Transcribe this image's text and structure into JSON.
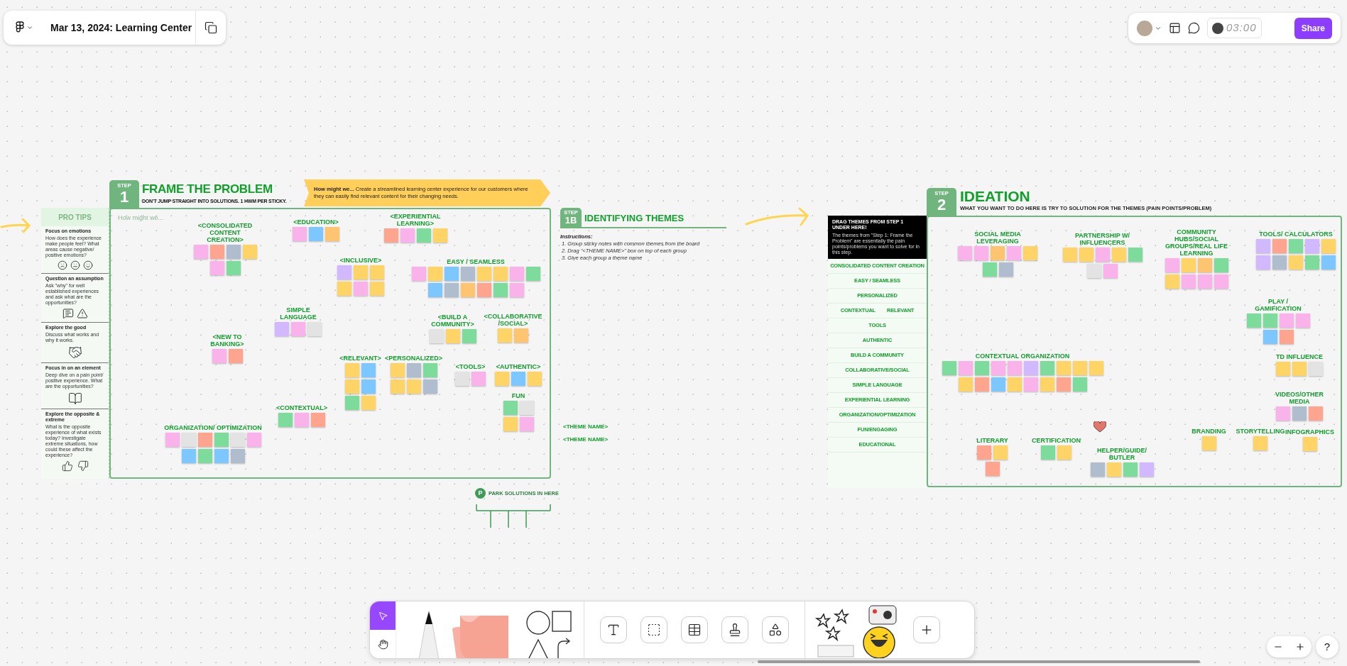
{
  "header": {
    "title": "Mar 13, 2024: Learning Center"
  },
  "top_right": {
    "timer": "03:00",
    "share": "Share"
  },
  "frame_problem": {
    "step_label": "STEP",
    "step_number": "1",
    "title": "FRAME THE PROBLEM",
    "subtitle": "DON'T JUMP STRAIGHT INTO SOLUTIONS. 1 HWM PER STICKY.",
    "hmw": "**How might we...** Create a streamlined learning center experience for our customers where they can easily find relevant content for their changing needs.",
    "placeholder": "How might we...",
    "pro_tips": {
      "title": "PRO TIPS",
      "tips": [
        {
          "kind": "emotions",
          "heading": "Focus on emotions",
          "body": "How does the experience make people feel? What areas cause negative/ positive emotions?"
        },
        {
          "kind": "assumption",
          "heading": "Question an assumption",
          "body": "Ask \"why\" for well established experiences and ask what are the opportunities?"
        },
        {
          "kind": "good",
          "heading": "Explore the good",
          "body": "Discuss what works and why it works."
        },
        {
          "kind": "element",
          "heading": "Focus in on an element",
          "body": "Deep dive on a pain point/ positive experience. What are the opportunities?"
        },
        {
          "kind": "opposite",
          "heading": "Explore the opposite & extreme",
          "body": "What is the opposite experience of what exists today? Investigate extreme situations, how could these affect the experience?"
        }
      ]
    },
    "clusters": [
      {
        "label": "<CONSOLIDATED CONTENT CREATION>",
        "notes": [
          {
            "color": "#f9b2ea"
          },
          {
            "color": "#ffa48f"
          },
          {
            "color": "#b0bdcf"
          },
          {
            "color": "#ffd466"
          },
          {
            "color": "#f9b2ea"
          },
          {
            "color": "#7ddc9c"
          }
        ]
      },
      {
        "label": "<EDUCATION>",
        "notes": [
          {
            "color": "#f9b2ea"
          },
          {
            "color": "#7cc7ff"
          },
          {
            "color": "#ffc46f"
          }
        ]
      },
      {
        "label": "<EXPERIENTIAL LEARNING>",
        "notes": [
          {
            "color": "#ffa48f"
          },
          {
            "color": "#f9b2ea"
          },
          {
            "color": "#7ddc9c"
          },
          {
            "color": "#ffd466"
          }
        ]
      },
      {
        "label": "<INCLUSIVE>",
        "notes": [
          {
            "color": "#d2b8ff"
          },
          {
            "color": "#ffd466"
          },
          {
            "color": "#ffd466"
          },
          {
            "color": "#ffd466"
          },
          {
            "color": "#f9b2ea"
          },
          {
            "color": "#ffd466"
          }
        ]
      },
      {
        "label": "EASY / SEAMLESS",
        "notes": [
          {
            "color": "#f9b2ea"
          },
          {
            "color": "#ffd466"
          },
          {
            "color": "#7cc7ff"
          },
          {
            "color": "#b0bdcf"
          },
          {
            "color": "#ffd466"
          },
          {
            "color": "#ffd466"
          },
          {
            "color": "#f9b2ea"
          },
          {
            "color": "#7ddc9c"
          },
          {
            "color": "#7cc7ff"
          },
          {
            "color": "#b0bdcf"
          },
          {
            "color": "#ffc46f"
          },
          {
            "color": "#ffa48f"
          },
          {
            "color": "#7ddc9c"
          },
          {
            "color": "#f9b2ea"
          }
        ]
      },
      {
        "label": "SIMPLE LANGUAGE",
        "notes": [
          {
            "color": "#d2b8ff"
          },
          {
            "color": "#f9b2ea"
          },
          {
            "color": "#e3e3e3"
          }
        ]
      },
      {
        "label": "<BUILD A COMMUNITY>",
        "notes": [
          {
            "color": "#e3e3e3"
          },
          {
            "color": "#ffd466"
          },
          {
            "color": "#7ddc9c"
          }
        ]
      },
      {
        "label": "<COLLABORATIVE /SOCIAL>",
        "notes": [
          {
            "color": "#ffd466"
          },
          {
            "color": "#ffc46f"
          }
        ]
      },
      {
        "label": "<NEW TO BANKING>",
        "notes": [
          {
            "color": "#f9b2ea"
          },
          {
            "color": "#ffa48f"
          }
        ]
      },
      {
        "label": "<RELEVANT>",
        "notes": [
          {
            "color": "#ffd466"
          },
          {
            "color": "#7cc7ff"
          },
          {
            "color": "#ffd466"
          },
          {
            "color": "#7cc7ff"
          },
          {
            "color": "#7ddc9c"
          },
          {
            "color": "#ffd466"
          }
        ]
      },
      {
        "label": "<PERSONALIZED>",
        "notes": [
          {
            "color": "#ffd466"
          },
          {
            "color": "#b0bdcf"
          },
          {
            "color": "#7ddc9c"
          },
          {
            "color": "#ffd466"
          },
          {
            "color": "#ffd466"
          },
          {
            "color": "#b0bdcf"
          }
        ]
      },
      {
        "label": "<TOOLS>",
        "notes": [
          {
            "color": "#e3e3e3"
          },
          {
            "color": "#f9b2ea"
          }
        ]
      },
      {
        "label": "<AUTHENTIC>",
        "notes": [
          {
            "color": "#ffd466"
          },
          {
            "color": "#7cc7ff"
          },
          {
            "color": "#ffd466"
          }
        ]
      },
      {
        "label": "FUN",
        "notes": [
          {
            "color": "#7ddc9c"
          },
          {
            "color": "#e3e3e3"
          },
          {
            "color": "#ffd466"
          },
          {
            "color": "#f9b2ea"
          }
        ]
      },
      {
        "label": "<CONTEXTUAL>",
        "notes": [
          {
            "color": "#7ddc9c"
          },
          {
            "color": "#f9b2ea"
          },
          {
            "color": "#ffa48f"
          }
        ]
      },
      {
        "label": "ORGANIZATION/ OPTIMIZATION",
        "notes": [
          {
            "color": "#f9b2ea"
          },
          {
            "color": "#e3e3e3"
          },
          {
            "color": "#ffa48f"
          },
          {
            "color": "#7ddc9c"
          },
          {
            "color": "#e3e3e3"
          },
          {
            "color": "#f9b2ea"
          },
          {
            "color": "#7cc7ff"
          },
          {
            "color": "#7ddc9c"
          },
          {
            "color": "#7cc7ff"
          },
          {
            "color": "#b0bdcf"
          }
        ]
      }
    ]
  },
  "frame_themes": {
    "step_label": "STEP",
    "step_number": "1B",
    "title": "IDENTIFYING THEMES",
    "instructions_title": "Instructions:",
    "instructions": [
      "1. Group sticky notes with common themes from the board",
      "2. Drag \"<THEME NAME>\" box on top of each group",
      "3. Give each group a theme name"
    ],
    "theme_names": [
      "<THEME NAME>",
      "<THEME NAME>"
    ]
  },
  "parking": {
    "badge": "P",
    "label": "PARK SOLUTIONS IN HERE"
  },
  "frame_ideation": {
    "step_label": "STEP",
    "step_number": "2",
    "title": "IDEATION",
    "subtitle": "WHAT YOU WANT TO DO HERE IS TRY TO SOLUTION FOR THE THEMES (PAIN POINTS/PROBLEM)",
    "themes_box": {
      "title": "DRAG THEMES FROM STEP 1 UNDER HERE!",
      "body": "The themes from \"Step 1: Frame the Problem\" are essentially the pain points/problems you want to solve for in this step."
    },
    "themes": [
      {
        "labels": [
          "CONSOLIDATED CONTENT CREATION"
        ]
      },
      {
        "labels": [
          "EASY / SEAMLESS"
        ]
      },
      {
        "labels": [
          "PERSONALIZED"
        ]
      },
      {
        "labels": [
          "CONTEXTUAL",
          "RELEVANT"
        ]
      },
      {
        "labels": [
          "TOOLS"
        ]
      },
      {
        "labels": [
          "AUTHENTIC"
        ]
      },
      {
        "labels": [
          "BUILD A COMMUNITY"
        ]
      },
      {
        "labels": [
          "COLLABORATIVE/SOCIAL"
        ]
      },
      {
        "labels": [
          "SIMPLE LANGUAGE"
        ]
      },
      {
        "labels": [
          "EXPERIENTIAL LEARNING"
        ]
      },
      {
        "labels": [
          "ORGANIZATION/OPTIMIZATION"
        ]
      },
      {
        "labels": [
          "FUN/ENGAGING"
        ]
      },
      {
        "labels": [
          "EDUCATIONAL"
        ]
      }
    ],
    "clusters": [
      {
        "label": "SOCIAL MEDIA LEVERAGING",
        "notes": [
          {
            "color": "#f9b2ea"
          },
          {
            "color": "#f9b2ea"
          },
          {
            "color": "#ffc46f"
          },
          {
            "color": "#f9b2ea"
          },
          {
            "color": "#ffd466"
          },
          {
            "color": "#7ddc9c"
          },
          {
            "color": "#b0bdcf"
          }
        ]
      },
      {
        "label": "PARTNERSHIP W/ INFLUENCERS",
        "notes": [
          {
            "color": "#ffd466"
          },
          {
            "color": "#ffd466"
          },
          {
            "color": "#f9b2ea"
          },
          {
            "color": "#ffd466"
          },
          {
            "color": "#7ddc9c"
          },
          {
            "color": "#e3e3e3"
          },
          {
            "color": "#f9b2ea"
          }
        ]
      },
      {
        "label": "COMMUNITY HUBS/SOCIAL GROUPS/REAL LIFE LEARNING",
        "notes": [
          {
            "color": "#f9b2ea"
          },
          {
            "color": "#ffd466"
          },
          {
            "color": "#ffc46f"
          },
          {
            "color": "#7ddc9c"
          },
          {
            "color": "#ffd466"
          },
          {
            "color": "#f9b2ea"
          },
          {
            "color": "#f9b2ea"
          },
          {
            "color": "#f9b2ea"
          }
        ]
      },
      {
        "label": "TOOLS/ CALCULATORS",
        "notes": [
          {
            "color": "#d2b8ff"
          },
          {
            "color": "#ffa48f"
          },
          {
            "color": "#7ddc9c"
          },
          {
            "color": "#d2b8ff"
          },
          {
            "color": "#ffd466"
          },
          {
            "color": "#d2b8ff"
          },
          {
            "color": "#b0bdcf"
          },
          {
            "color": "#ffd466"
          },
          {
            "color": "#7ddc9c"
          },
          {
            "color": "#7cc7ff"
          }
        ]
      },
      {
        "label": "PLAY / GAMIFICATION",
        "notes": [
          {
            "color": "#7ddc9c"
          },
          {
            "color": "#7ddc9c"
          },
          {
            "color": "#f9b2ea"
          },
          {
            "color": "#f9b2ea"
          },
          {
            "color": "#7cc7ff"
          },
          {
            "color": "#ffa48f"
          }
        ]
      },
      {
        "label": "CONTEXTUAL ORGANIZATION",
        "notes": [
          {
            "color": "#7ddc9c"
          },
          {
            "color": "#f9b2ea"
          },
          {
            "color": "#7ddc9c"
          },
          {
            "color": "#f9b2ea"
          },
          {
            "color": "#f9b2ea"
          },
          {
            "color": "#d2b8ff"
          },
          {
            "color": "#7ddc9c"
          },
          {
            "color": "#ffd466"
          },
          {
            "color": "#ffd466"
          },
          {
            "color": "#ffd466"
          },
          {
            "color": "#ffd466"
          },
          {
            "color": "#ffa48f"
          },
          {
            "color": "#7cc7ff"
          },
          {
            "color": "#ffd466"
          },
          {
            "color": "#f9b2ea"
          },
          {
            "color": "#ffd466"
          },
          {
            "color": "#ffa48f"
          },
          {
            "color": "#7ddc9c"
          }
        ]
      },
      {
        "label": "TD INFLUENCE",
        "notes": [
          {
            "color": "#ffd466"
          },
          {
            "color": "#ffd466"
          },
          {
            "color": "#e3e3e3"
          }
        ]
      },
      {
        "label": "VIDEOS/OTHER MEDIA",
        "notes": [
          {
            "color": "#f9b2ea"
          },
          {
            "color": "#b0bdcf"
          },
          {
            "color": "#ffa48f"
          }
        ]
      },
      {
        "label": "LITERARY",
        "notes": [
          {
            "color": "#ffa48f"
          },
          {
            "color": "#ffd466"
          },
          {
            "color": "#ffa48f"
          }
        ]
      },
      {
        "label": "CERTIFICATION",
        "notes": [
          {
            "color": "#7ddc9c"
          },
          {
            "color": "#ffd466"
          }
        ]
      },
      {
        "label": "HELPER/GUIDE/ BUTLER",
        "notes": [
          {
            "color": "#b0bdcf"
          },
          {
            "color": "#ffd466"
          },
          {
            "color": "#7ddc9c"
          },
          {
            "color": "#d2b8ff"
          }
        ]
      },
      {
        "label": "BRANDING",
        "notes": [
          {
            "color": "#ffd466"
          }
        ]
      },
      {
        "label": "STORYTELLING",
        "notes": [
          {
            "color": "#ffd466"
          }
        ]
      },
      {
        "label": "INFOGRAPHICS",
        "notes": [
          {
            "color": "#ffd466"
          }
        ]
      }
    ]
  },
  "bottom_toolbar": {
    "tools": [
      {
        "kind": "select",
        "selected": true
      },
      {
        "kind": "hand",
        "selected": false
      }
    ]
  },
  "help": "?"
}
